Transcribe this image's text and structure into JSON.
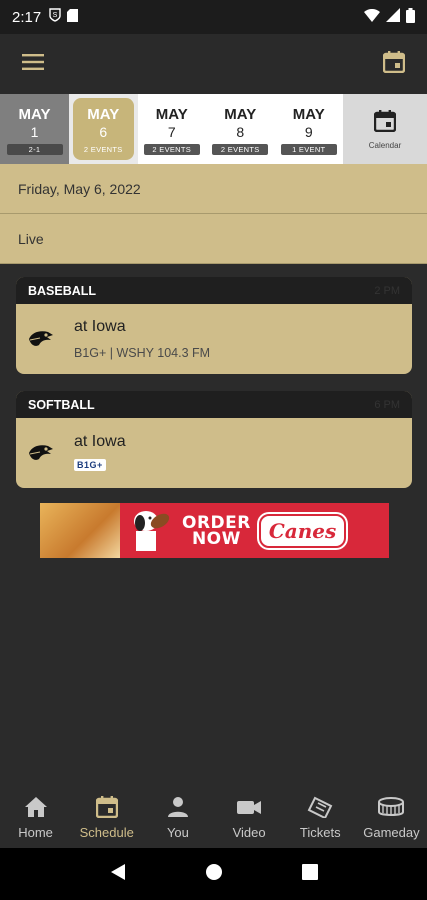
{
  "status_bar": {
    "time": "2:17"
  },
  "date_strip": {
    "days": [
      {
        "month": "MAY",
        "day": "1",
        "badge": "2-1"
      },
      {
        "month": "MAY",
        "day": "6",
        "badge": "2 EVENTS"
      },
      {
        "month": "MAY",
        "day": "7",
        "badge": "2 EVENTS"
      },
      {
        "month": "MAY",
        "day": "8",
        "badge": "2 EVENTS"
      },
      {
        "month": "MAY",
        "day": "9",
        "badge": "1 EVENT"
      }
    ],
    "calendar_label": "Calendar"
  },
  "date_header": "Friday, May 6, 2022",
  "live_header": "Live",
  "events": [
    {
      "sport": "BASEBALL",
      "time": "2 PM",
      "opponent": "at Iowa",
      "broadcast": "B1G+ | WSHY 104.3 FM"
    },
    {
      "sport": "SOFTBALL",
      "time": "6 PM",
      "opponent": "at Iowa",
      "broadcast_logo": "B1G+"
    }
  ],
  "ad": {
    "headline_1": "ORDER",
    "headline_2": "NOW",
    "brand": "Canes"
  },
  "bottom_nav": {
    "items": [
      {
        "label": "Home",
        "icon": "home-icon"
      },
      {
        "label": "Schedule",
        "icon": "calendar-icon"
      },
      {
        "label": "You",
        "icon": "person-icon"
      },
      {
        "label": "Video",
        "icon": "video-camera-icon"
      },
      {
        "label": "Tickets",
        "icon": "ticket-icon"
      },
      {
        "label": "Gameday",
        "icon": "stadium-icon"
      }
    ],
    "active": "Schedule"
  },
  "colors": {
    "accent": "#cfbd8a",
    "background": "#2b2b2b",
    "header": "#1f1f1f"
  }
}
